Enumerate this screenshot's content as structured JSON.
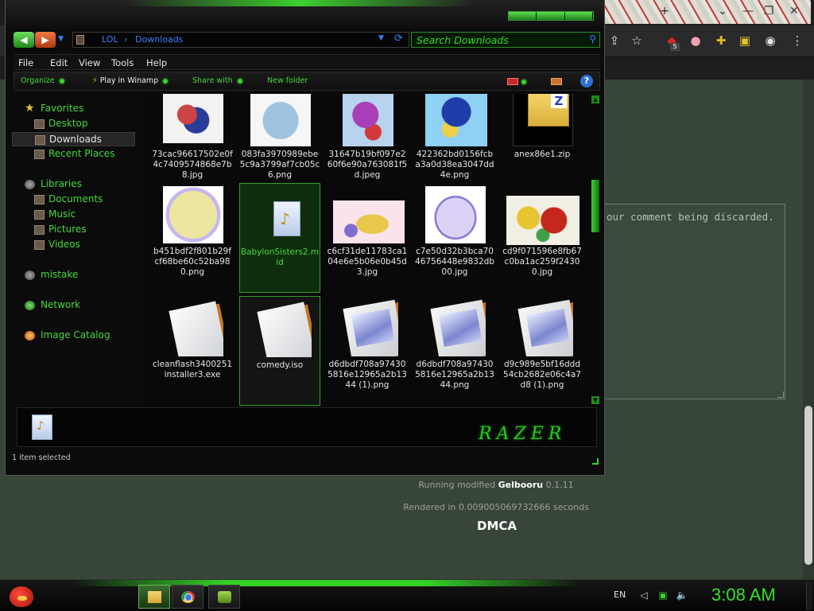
{
  "browser": {
    "comment_text": "our comment being discarded.",
    "footer": {
      "line1_prefix": "Running modified ",
      "line1_brand": "Gelbooru",
      "line1_version": " 0.1.11",
      "line2": "Rendered in 0.009005069732666 seconds",
      "dmca": "DMCA"
    },
    "extension_badge": "5"
  },
  "explorer": {
    "breadcrumb": [
      "LOL",
      "Downloads"
    ],
    "search_placeholder": "Search Downloads",
    "menu": [
      "File",
      "Edit",
      "View",
      "Tools",
      "Help"
    ],
    "commands": {
      "organize": "Organize",
      "play": "Play in Winamp",
      "share": "Share with",
      "new_folder": "New folder"
    },
    "nav": {
      "favorites": "Favorites",
      "desktop": "Desktop",
      "downloads": "Downloads",
      "recent": "Recent Places",
      "libraries": "Libraries",
      "documents": "Documents",
      "music": "Music",
      "pictures": "Pictures",
      "videos": "Videos",
      "mistake": "mistake",
      "network": "Network",
      "image_catalog": "Image Catalog"
    },
    "files": [
      "73cac96617502e0f4c7409574868e7b8.jpg",
      "083fa3970989ebe5c9a3799af7cb05c6.png",
      "31647b19bf097e260f6e90a763081f5d.jpeg",
      "422362bd0156fcba3a0d38ea3047dd4e.png",
      "anex86e1.zip",
      "b451bdf2f801b29fcf68be60c52ba980.png",
      "BabylonSisters2.mid",
      "c6cf31de11783ca104e6e5b06e0b45d3.jpg",
      "c7e50d32b3bca7046756448e9832db00.jpg",
      "cd9f071596e8fb67c0ba1ac259f24300.jpg",
      "cleanflash3400251installer3.exe",
      "comedy.iso",
      "d6dbdf708a974305816e12965a2b1344 (1).png",
      "d6dbdf708a974305816e12965a2b1344.png",
      "d9c989e5bf16ddd54cb2682e06c4a7d8 (1).png"
    ],
    "details_logo": "RAZER",
    "status": "1 item selected"
  },
  "taskbar": {
    "lang": "EN",
    "clock": "3:08 AM"
  }
}
